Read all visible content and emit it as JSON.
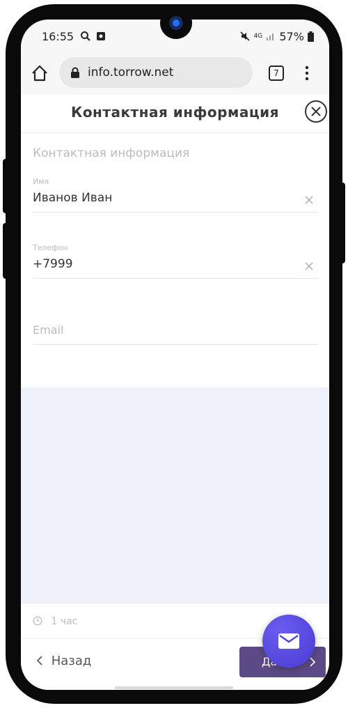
{
  "status": {
    "time": "16:55",
    "signal": "4G",
    "battery": "57%"
  },
  "browser": {
    "url": "info.torrow.net",
    "tab_count": "7"
  },
  "header": {
    "title": "Контактная информация"
  },
  "form": {
    "section_title": "Контактная информация",
    "name_label": "Имя",
    "name_value": "Иванов Иван",
    "phone_label": "Телефон",
    "phone_value": "+7999",
    "email_placeholder": "Email"
  },
  "footer": {
    "duration": "1 час",
    "back_label": "Назад",
    "next_label": "Да"
  },
  "colors": {
    "accent": "#5b4a86",
    "fab": "#5143e0",
    "background_tint": "#eef3fb"
  }
}
